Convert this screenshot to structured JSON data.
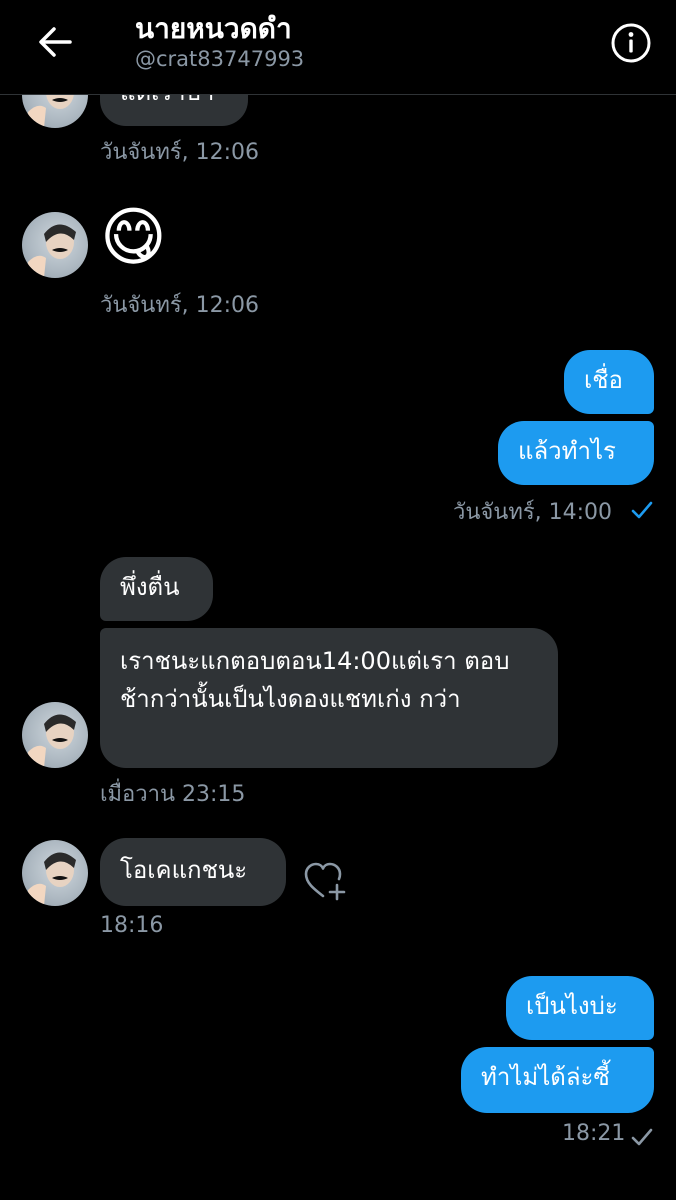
{
  "header": {
    "name": "นายหนวดดำ",
    "handle": "@crat83747993"
  },
  "messages": {
    "m0_text": "แต่เราบ้า",
    "m0_time": "วันจันทร์, 12:06",
    "m1_emoji": "😋",
    "m1_time": "วันจันทร์, 12:06",
    "out1_a": "เชื่อ",
    "out1_b": "แล้วทำไร",
    "out1_time": "วันจันทร์, 14:00",
    "in2_a": "พึ่งตื่น",
    "in2_b": "เราชนะแกตอบตอน14:00แต่เรา ตอบช้ากว่านั้นเป็นไงดองแชทเก่ง กว่า",
    "in2_time": "เมื่อวาน 23:15",
    "in3_a": "โอเคแกชนะ",
    "in3_time": "18:16",
    "out2_a": "เป็นไงบ่ะ",
    "out2_b": "ทำไม่ได้ล่ะซี้",
    "out2_time": "18:21"
  },
  "colors": {
    "outgoing": "#1d9bf0",
    "incoming": "#2f3336",
    "muted": "#8b98a5",
    "read_check": "#1d9bf0"
  },
  "icons": {
    "back": "arrow-left-icon",
    "info": "info-icon",
    "check": "check-icon",
    "heart_add": "heart-plus-icon"
  }
}
